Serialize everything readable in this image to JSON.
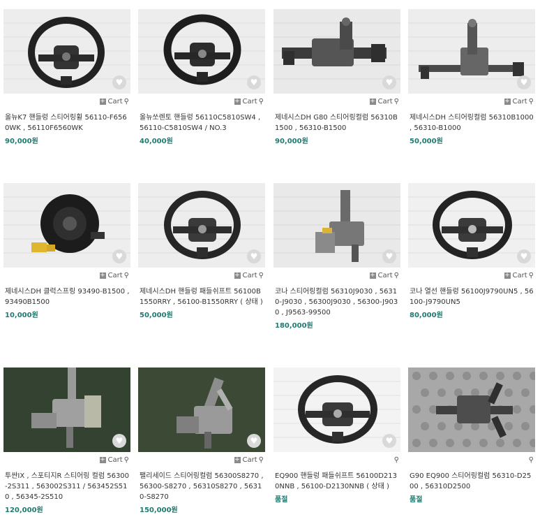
{
  "products": [
    {
      "title": "올뉴K7 핸들렁 스티어링휠 56110-F6560WK , 56110F6560WK",
      "price": "90,000원",
      "cart_label": "Cart",
      "image": "steering-wheel",
      "bg": "wall",
      "has_cart": true
    },
    {
      "title": "올뉴쏘렌토 핸들렁 56110C5810SW4 , 56110-C5810SW4 / NO.3",
      "price": "40,000원",
      "cart_label": "Cart",
      "image": "steering-wheel",
      "bg": "wall",
      "has_cart": true
    },
    {
      "title": "제네시스DH G80 스티어링컬럼 56310B1500 , 56310-B1500",
      "price": "90,000원",
      "cart_label": "Cart",
      "image": "steering-column",
      "bg": "wall",
      "has_cart": true
    },
    {
      "title": "제네시스DH 스티어링컬럼 56310B1000 , 56310-B1000",
      "price": "50,000원",
      "cart_label": "Cart",
      "image": "steering-column",
      "bg": "wall",
      "has_cart": true
    },
    {
      "title": "제네시스DH 클럭스프링 93490-B1500 , 93490B1500",
      "price": "10,000원",
      "cart_label": "Cart",
      "image": "clock-spring",
      "bg": "wall",
      "has_cart": true
    },
    {
      "title": "제네시스DH 핸들렁 패들쉬프트 56100B1550RRY , 56100-B1550RRY ( 상태 )",
      "price": "50,000원",
      "cart_label": "Cart",
      "image": "steering-wheel",
      "bg": "wall",
      "has_cart": true
    },
    {
      "title": "코나 스티어링컬럼 56310J9030 , 56310-J9030 , 56300J9030 , 56300-J9030 , J9563-99500",
      "price": "180,000원",
      "cart_label": "Cart",
      "image": "steering-column-vertical",
      "bg": "wall",
      "has_cart": true
    },
    {
      "title": "코나 열선 핸들렁 56100J9790UN5 , 56100-J9790UN5",
      "price": "80,000원",
      "cart_label": "Cart",
      "image": "steering-wheel",
      "bg": "wall",
      "has_cart": true
    },
    {
      "title": "투싼IX , 스포티지R 스티어링 컬럼 56300-2S311 , 563002S311 / 563452S510 , 56345-2S510",
      "price": "120,000원",
      "cart_label": "Cart",
      "image": "steering-column-vertical",
      "bg": "green",
      "has_cart": true
    },
    {
      "title": "팰리세이드 스티어링컬럼 56300S8270 , 56300-S8270 , 56310S8270 , 56310-S8270",
      "price": "150,000원",
      "cart_label": "Cart",
      "image": "steering-column-vertical",
      "bg": "green",
      "has_cart": true
    },
    {
      "title": "EQ900 핸들렁 패들쉬프트 56100D2130NNB , 56100-D2130NNB ( 상태 )",
      "price": "품절",
      "cart_label": "",
      "image": "steering-wheel",
      "bg": "wall",
      "has_cart": false
    },
    {
      "title": "G90 EQ900 스티어링컬럼 56310-D2500 , 56310D2500",
      "price": "품절",
      "cart_label": "",
      "image": "steering-column-vertical",
      "bg": "foam",
      "has_cart": false
    }
  ],
  "colors": {
    "price": "#1f7a6f",
    "heart_bg": "#d9d9d9"
  }
}
